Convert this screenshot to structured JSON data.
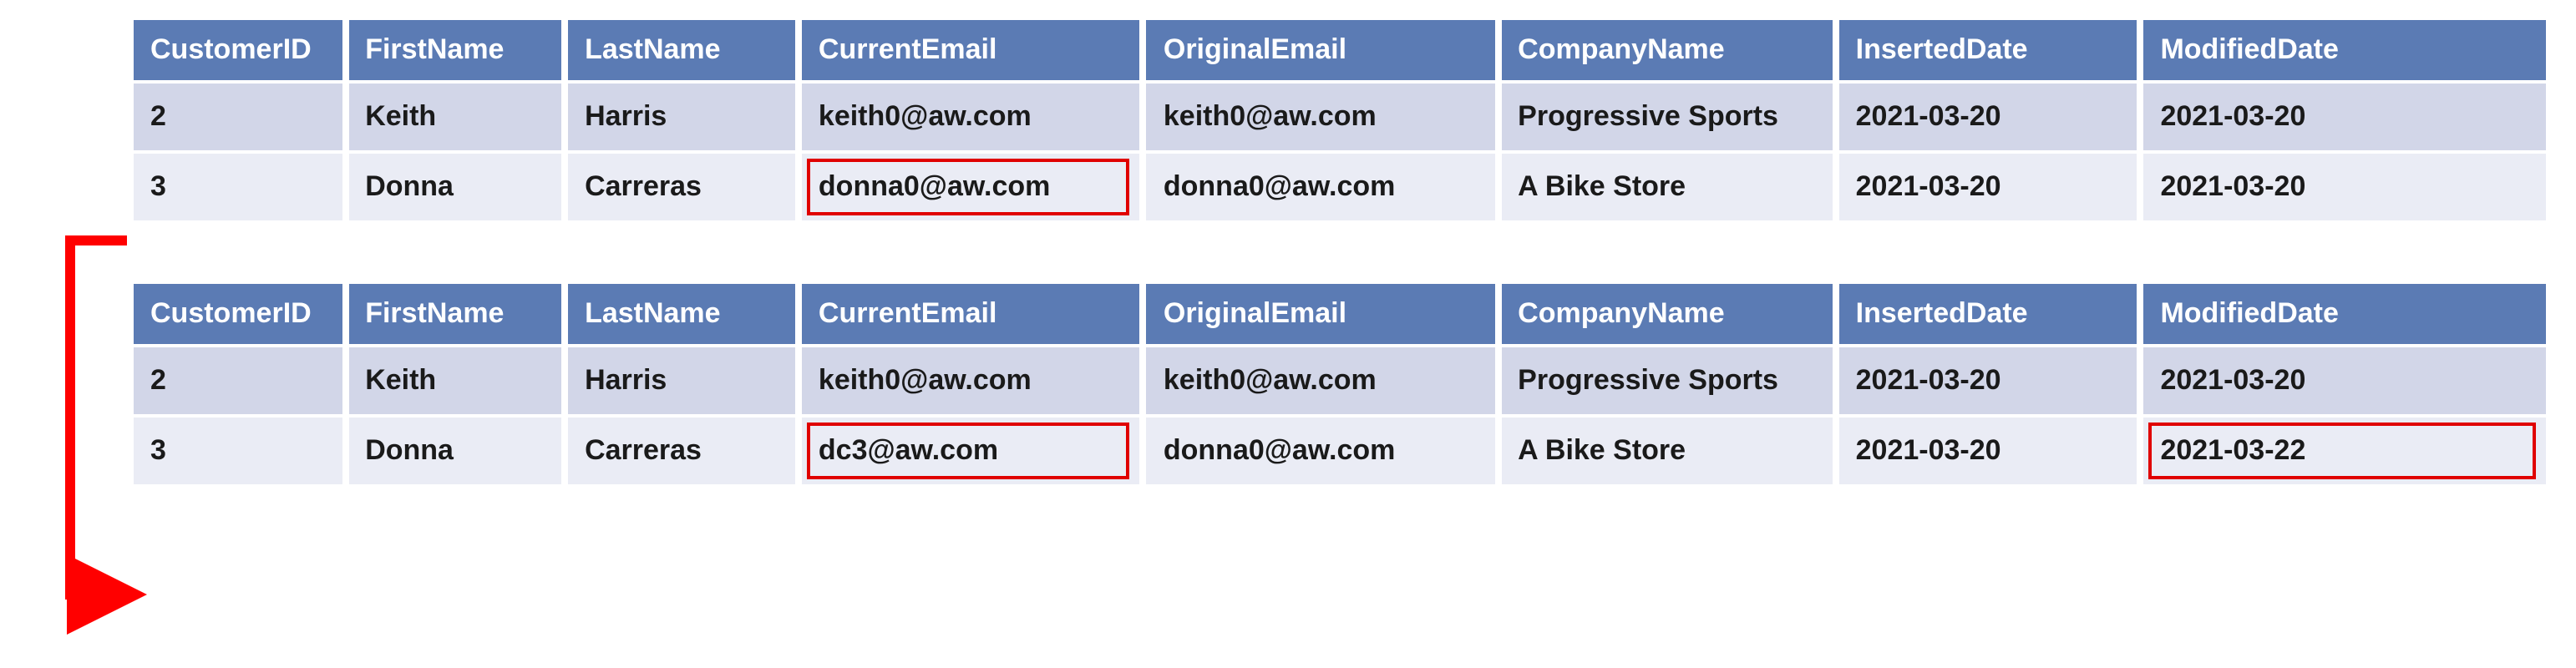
{
  "columns": {
    "customerId": "CustomerID",
    "firstName": "FirstName",
    "lastName": "LastName",
    "currentEmail": "CurrentEmail",
    "originalEmail": "OriginalEmail",
    "companyName": "CompanyName",
    "insertedDate": "InsertedDate",
    "modifiedDate": "ModifiedDate"
  },
  "table1": {
    "rows": [
      {
        "customerId": "2",
        "firstName": "Keith",
        "lastName": "Harris",
        "currentEmail": "keith0@aw.com",
        "originalEmail": "keith0@aw.com",
        "companyName": "Progressive Sports",
        "insertedDate": "2021-03-20",
        "modifiedDate": "2021-03-20"
      },
      {
        "customerId": "3",
        "firstName": "Donna",
        "lastName": "Carreras",
        "currentEmail": "donna0@aw.com",
        "originalEmail": "donna0@aw.com",
        "companyName": "A Bike Store",
        "insertedDate": "2021-03-20",
        "modifiedDate": "2021-03-20"
      }
    ]
  },
  "table2": {
    "rows": [
      {
        "customerId": "2",
        "firstName": "Keith",
        "lastName": "Harris",
        "currentEmail": "keith0@aw.com",
        "originalEmail": "keith0@aw.com",
        "companyName": "Progressive Sports",
        "insertedDate": "2021-03-20",
        "modifiedDate": "2021-03-20"
      },
      {
        "customerId": "3",
        "firstName": "Donna",
        "lastName": "Carreras",
        "currentEmail": "dc3@aw.com",
        "originalEmail": "donna0@aw.com",
        "companyName": "A Bike Store",
        "insertedDate": "2021-03-20",
        "modifiedDate": "2021-03-22"
      }
    ]
  },
  "highlights": {
    "table1": [
      {
        "row": 1,
        "col": "currentEmail"
      }
    ],
    "table2": [
      {
        "row": 1,
        "col": "currentEmail"
      },
      {
        "row": 1,
        "col": "modifiedDate"
      }
    ]
  }
}
